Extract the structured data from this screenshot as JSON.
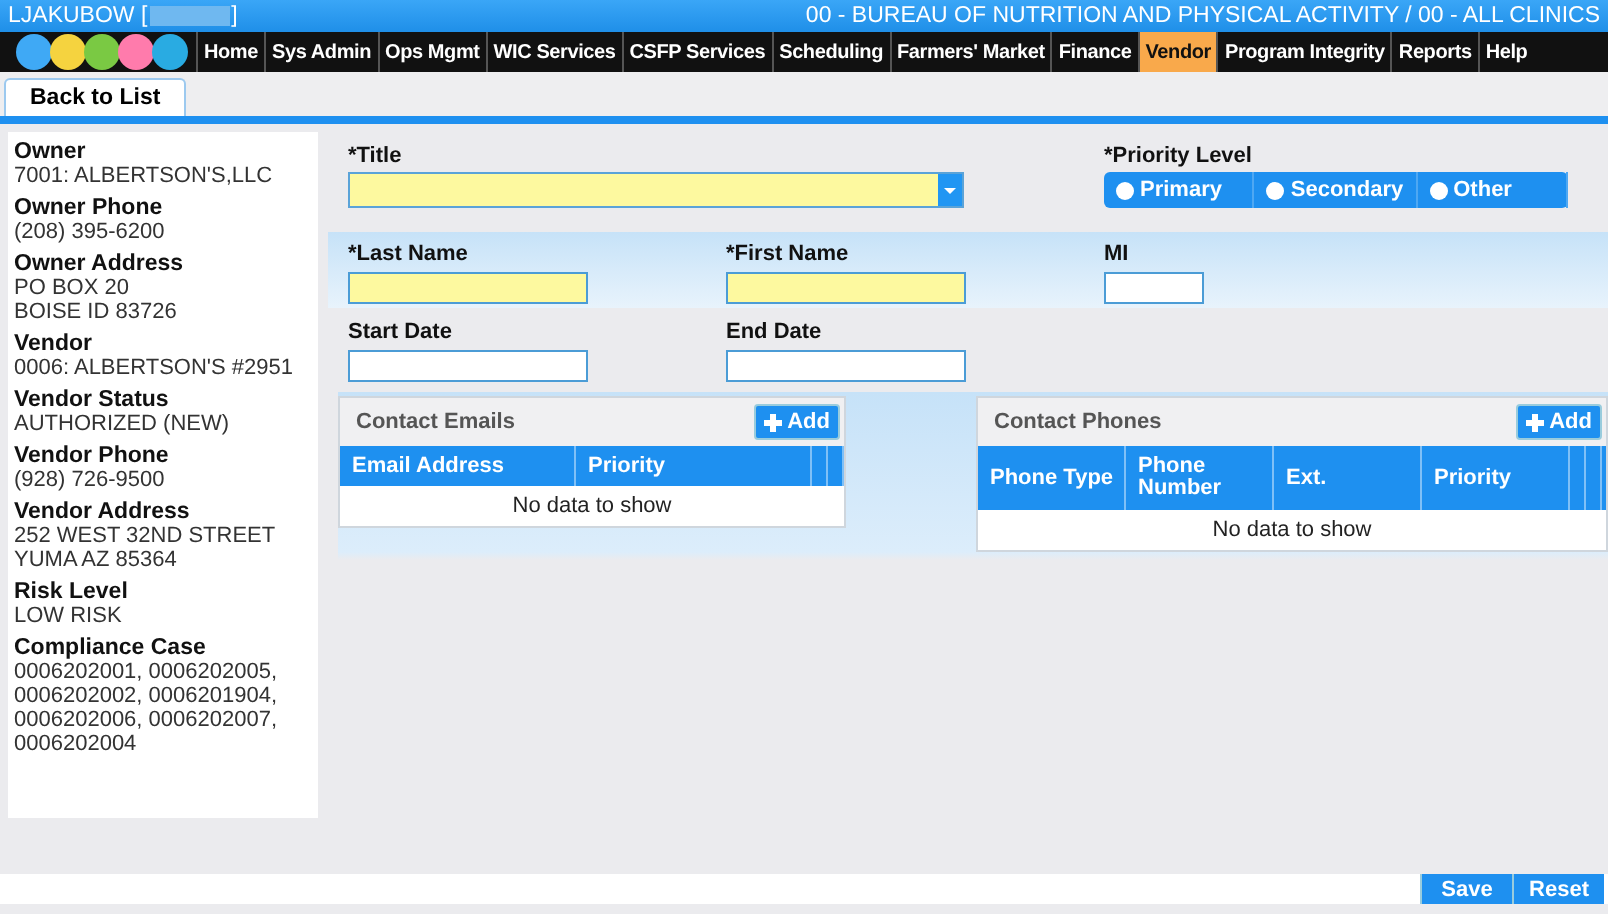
{
  "header": {
    "user": "LJAKUBOW [",
    "user_end": "]",
    "agency": "00 - BUREAU OF NUTRITION AND PHYSICAL ACTIVITY / 00 - ALL CLINICS"
  },
  "nav": [
    {
      "label": "Home",
      "selected": false
    },
    {
      "label": "Sys Admin",
      "selected": false
    },
    {
      "label": "Ops Mgmt",
      "selected": false
    },
    {
      "label": "WIC Services",
      "selected": false
    },
    {
      "label": "CSFP Services",
      "selected": false
    },
    {
      "label": "Scheduling",
      "selected": false
    },
    {
      "label": "Farmers' Market",
      "selected": false
    },
    {
      "label": "Finance",
      "selected": false
    },
    {
      "label": "Vendor",
      "selected": true
    },
    {
      "label": "Program Integrity",
      "selected": false
    },
    {
      "label": "Reports",
      "selected": false
    },
    {
      "label": "Help",
      "selected": false
    }
  ],
  "toolbar": {
    "back_button": "Back to List"
  },
  "sidebar": [
    {
      "label": "Owner",
      "lines": [
        "7001: ALBERTSON'S,LLC"
      ]
    },
    {
      "label": "Owner Phone",
      "lines": [
        "(208) 395-6200"
      ]
    },
    {
      "label": "Owner Address",
      "lines": [
        "PO BOX 20",
        "BOISE ID 83726"
      ]
    },
    {
      "label": "Vendor",
      "lines": [
        "0006: ALBERTSON'S #2951"
      ]
    },
    {
      "label": "Vendor Status",
      "lines": [
        "AUTHORIZED (NEW)"
      ]
    },
    {
      "label": "Vendor Phone",
      "lines": [
        "(928) 726-9500"
      ]
    },
    {
      "label": "Vendor Address",
      "lines": [
        "252 WEST 32ND STREET",
        "YUMA AZ 85364"
      ]
    },
    {
      "label": "Risk Level",
      "lines": [
        "LOW RISK"
      ]
    },
    {
      "label": "Compliance Case",
      "lines": [
        "0006202001, 0006202005,",
        "0006202002, 0006201904,",
        "0006202006, 0006202007,",
        "0006202004"
      ]
    }
  ],
  "form": {
    "title_label": "*Title",
    "priority_label": "*Priority Level",
    "priority_options": [
      {
        "label": "Primary",
        "selected": false
      },
      {
        "label": "Secondary",
        "selected": false
      },
      {
        "label": "Other",
        "selected": false
      }
    ],
    "last_name_label": "*Last Name",
    "first_name_label": "*First Name",
    "mi_label": "MI",
    "start_date_label": "Start Date",
    "end_date_label": "End Date"
  },
  "contact_emails": {
    "title": "Contact Emails",
    "add_button": "Add",
    "columns": [
      "Email Address",
      "Priority"
    ],
    "empty": "No data to show"
  },
  "contact_phones": {
    "title": "Contact Phones",
    "add_button": "Add",
    "columns": [
      "Phone Type",
      "Phone Number",
      "Ext.",
      "Priority"
    ],
    "empty": "No data to show"
  },
  "footer": {
    "buttons": [
      "Save",
      "Reset"
    ]
  }
}
